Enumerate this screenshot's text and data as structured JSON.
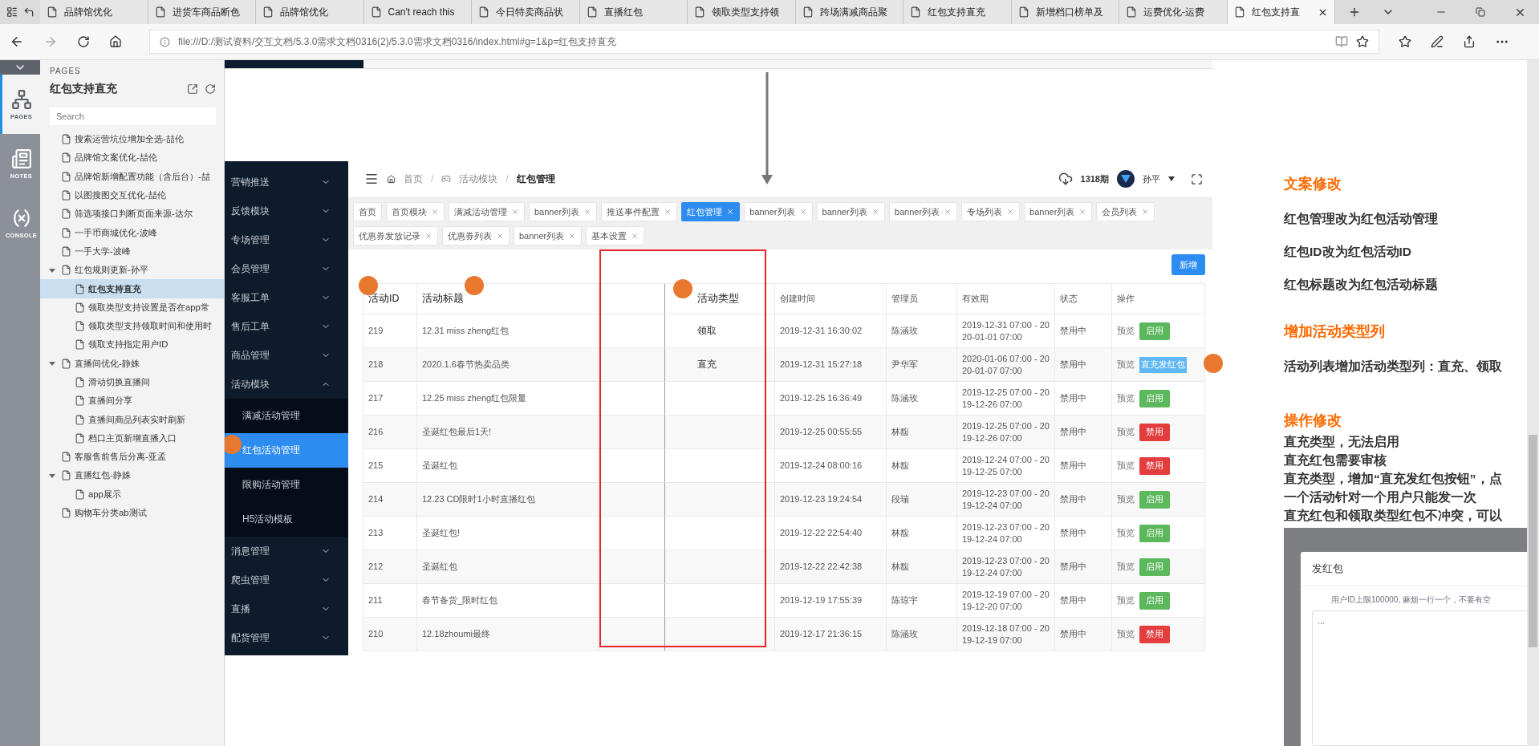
{
  "browser": {
    "tabs": [
      {
        "title": "品牌馆优化",
        "selected": false
      },
      {
        "title": "进货车商品断色",
        "selected": false
      },
      {
        "title": "品牌馆优化",
        "selected": false
      },
      {
        "title": "Can't reach this",
        "selected": false
      },
      {
        "title": "今日特卖商品状",
        "selected": false
      },
      {
        "title": "直播红包",
        "selected": false
      },
      {
        "title": "领取类型支持领",
        "selected": false
      },
      {
        "title": "跨场满减商品聚",
        "selected": false
      },
      {
        "title": "红包支持直充",
        "selected": false
      },
      {
        "title": "新增档口榜单及",
        "selected": false
      },
      {
        "title": "运费优化-运费",
        "selected": false
      },
      {
        "title": "红包支持直",
        "selected": true
      }
    ],
    "url": "file:///D:/测试资料/交互文档/5.3.0需求文档0316(2)/5.3.0需求文档0316/index.html#g=1&p=红包支持直充"
  },
  "rail": [
    {
      "label": "PAGES",
      "kind": "pages",
      "selected": true
    },
    {
      "label": "NOTES",
      "kind": "notes",
      "selected": false
    },
    {
      "label": "CONSOLE",
      "kind": "console",
      "selected": false
    }
  ],
  "pages": {
    "caption": "PAGES",
    "title": "红包支持直充",
    "search": {
      "placeholder": "Search"
    },
    "tree": [
      {
        "label": "搜索运营坑位增加全选-喆伦",
        "selected": false
      },
      {
        "label": "品牌馆文案优化-喆伦",
        "selected": false
      },
      {
        "label": "品牌馆新增配置功能（含后台）-喆",
        "selected": false
      },
      {
        "label": "以图搜图交互优化-喆伦",
        "selected": false
      },
      {
        "label": "筛选项接口判断页面来源-达尔",
        "selected": false
      },
      {
        "label": "一手币商城优化-波峰",
        "selected": false
      },
      {
        "label": "一手大学-波峰",
        "selected": false
      },
      {
        "label": "红包规则更新-孙平",
        "selected": false,
        "expanded": true,
        "children": [
          {
            "label": "红包支持直充",
            "selected": true
          },
          {
            "label": "领取类型支持设置是否在app常",
            "selected": false
          },
          {
            "label": "领取类型支持领取时间和使用时",
            "selected": false
          },
          {
            "label": "领取支持指定用户ID",
            "selected": false
          }
        ]
      },
      {
        "label": "直播间优化-静姝",
        "selected": false,
        "expanded": true,
        "children": [
          {
            "label": "滑动切换直播间",
            "selected": false
          },
          {
            "label": "直播间分享",
            "selected": false
          },
          {
            "label": "直播间商品列表实时刷新",
            "selected": false
          },
          {
            "label": "档口主页新增直播入口",
            "selected": false
          }
        ]
      },
      {
        "label": "客服售前售后分离-亚孟",
        "selected": false
      },
      {
        "label": "直播红包-静姝",
        "selected": false,
        "expanded": true,
        "children": [
          {
            "label": "app展示",
            "selected": false
          }
        ]
      },
      {
        "label": "购物车分类ab测试",
        "selected": false
      }
    ]
  },
  "admin": {
    "menu": [
      {
        "label": "营销推送",
        "expanded": false
      },
      {
        "label": "反馈模块",
        "expanded": false
      },
      {
        "label": "专场管理",
        "expanded": false
      },
      {
        "label": "会员管理",
        "expanded": false
      },
      {
        "label": "客服工单",
        "expanded": false
      },
      {
        "label": "售后工单",
        "expanded": false
      },
      {
        "label": "商品管理",
        "expanded": false
      },
      {
        "label": "活动模块",
        "expanded": true,
        "children": [
          {
            "label": "满减活动管理",
            "selected": false
          },
          {
            "label": "红包活动管理",
            "selected": true
          },
          {
            "label": "限购活动管理",
            "selected": false
          },
          {
            "label": "H5活动模板",
            "selected": false
          }
        ]
      },
      {
        "label": "消息管理",
        "expanded": false
      },
      {
        "label": "爬虫管理",
        "expanded": false
      },
      {
        "label": "直播",
        "expanded": false
      },
      {
        "label": "配货管理",
        "expanded": false
      }
    ],
    "separator": "/",
    "breadcrumbs": [
      {
        "label": "首页",
        "kind": "home"
      },
      {
        "label": "活动模块",
        "kind": "module"
      },
      {
        "label": "红包管理",
        "kind": "page"
      }
    ],
    "issue": "1318期",
    "user": "孙平",
    "tag_rows": [
      [
        {
          "label": "首页",
          "selected": false,
          "closable": false
        },
        {
          "label": "首页模块",
          "selected": false,
          "closable": true
        },
        {
          "label": "满减活动管理",
          "selected": false,
          "closable": true
        },
        {
          "label": "banner列表",
          "selected": false,
          "closable": true
        },
        {
          "label": "推送事件配置",
          "selected": false,
          "closable": true
        },
        {
          "label": "红包管理",
          "selected": true,
          "closable": true
        },
        {
          "label": "banner列表",
          "selected": false,
          "closable": true
        },
        {
          "label": "banner列表",
          "selected": false,
          "closable": true
        },
        {
          "label": "banner列表",
          "selected": false,
          "closable": true
        },
        {
          "label": "专场列表",
          "selected": false,
          "closable": true
        },
        {
          "label": "banner列表",
          "selected": false,
          "closable": true
        },
        {
          "label": "会员列表",
          "selected": false,
          "closable": true
        }
      ],
      [
        {
          "label": "优惠券发放记录",
          "selected": false,
          "closable": true
        },
        {
          "label": "优惠券列表",
          "selected": false,
          "closable": true
        },
        {
          "label": "banner列表",
          "selected": false,
          "closable": true
        },
        {
          "label": "基本设置",
          "selected": false,
          "closable": true
        }
      ]
    ],
    "add_button": "新增",
    "columns": [
      {
        "label": "活动ID",
        "kind": "text"
      },
      {
        "label": "活动标题",
        "kind": "text"
      },
      {
        "kind": "blank"
      },
      {
        "label": "活动类型",
        "kind": "type"
      },
      {
        "label": "创建时间",
        "kind": "text"
      },
      {
        "label": "管理员",
        "kind": "text"
      },
      {
        "label": "有效期",
        "kind": "wrap"
      },
      {
        "label": "状态",
        "kind": "text"
      },
      {
        "label": "操作",
        "kind": "actions"
      }
    ],
    "rows": [
      {
        "id": "219",
        "title": "12.31 miss zheng红包",
        "type": "领取",
        "created": "2019-12-31 16:30:02",
        "admin": "陈涵玫",
        "validity": "2019-12-31 07:00 - 2020-01-01 07:00",
        "status": "禁用中",
        "preview": "预览",
        "action": {
          "label": "启用",
          "kind": "enable"
        }
      },
      {
        "id": "218",
        "title": "2020.1.6春节热卖品类",
        "type": "直充",
        "created": "2019-12-31 15:27:18",
        "admin": "尹华军",
        "validity": "2020-01-06 07:00 - 2020-01-07 07:00",
        "status": "禁用中",
        "preview": "预览",
        "action": {
          "label": "直充发红包",
          "kind": "send"
        }
      },
      {
        "id": "217",
        "title": "12.25 miss zheng红包限量",
        "created": "2019-12-25 16:36:49",
        "admin": "陈涵玫",
        "validity": "2019-12-25 07:00 - 2019-12-26 07:00",
        "status": "禁用中",
        "preview": "预览",
        "action": {
          "label": "启用",
          "kind": "enable"
        }
      },
      {
        "id": "216",
        "title": "圣诞红包最后1天!",
        "created": "2019-12-25 00:55:55",
        "admin": "林馥",
        "validity": "2019-12-25 07:00 - 2019-12-26 07:00",
        "status": "禁用中",
        "preview": "预览",
        "action": {
          "label": "禁用",
          "kind": "disable"
        }
      },
      {
        "id": "215",
        "title": "圣诞红包",
        "created": "2019-12-24 08:00:16",
        "admin": "林馥",
        "validity": "2019-12-24 07:00 - 2019-12-25 07:00",
        "status": "禁用中",
        "preview": "预览",
        "action": {
          "label": "禁用",
          "kind": "disable"
        }
      },
      {
        "id": "214",
        "title": "12.23 CD限时1小时直播红包",
        "created": "2019-12-23 19:24:54",
        "admin": "段瑞",
        "validity": "2019-12-23 07:00 - 2019-12-24 07:00",
        "status": "禁用中",
        "preview": "预览",
        "action": {
          "label": "启用",
          "kind": "enable"
        }
      },
      {
        "id": "213",
        "title": "圣诞红包!",
        "created": "2019-12-22 22:54:40",
        "admin": "林馥",
        "validity": "2019-12-23 07:00 - 2019-12-24 07:00",
        "status": "禁用中",
        "preview": "预览",
        "action": {
          "label": "启用",
          "kind": "enable"
        }
      },
      {
        "id": "212",
        "title": "圣诞红包",
        "created": "2019-12-22 22:42:38",
        "admin": "林馥",
        "validity": "2019-12-23 07:00 - 2019-12-24 07:00",
        "status": "禁用中",
        "preview": "预览",
        "action": {
          "label": "启用",
          "kind": "enable"
        }
      },
      {
        "id": "211",
        "title": "春节备货_限时红包",
        "created": "2019-12-19 17:55:39",
        "admin": "陈琼宇",
        "validity": "2019-12-19 07:00 - 2019-12-20 07:00",
        "status": "禁用中",
        "preview": "预览",
        "action": {
          "label": "启用",
          "kind": "enable"
        }
      },
      {
        "id": "210",
        "title": "12.18zhoumi最终",
        "created": "2019-12-17 21:36:15",
        "admin": "陈涵玫",
        "validity": "2019-12-18 07:00 - 2019-12-19 07:00",
        "status": "禁用中",
        "preview": "预览",
        "action": {
          "label": "禁用",
          "kind": "disable"
        }
      }
    ]
  },
  "notes": [
    {
      "heading": "文案修改",
      "kind": "spaced",
      "lines": [
        "红包管理改为红包活动管理",
        "红包ID改为红包活动ID",
        "红包标题改为红包活动标题"
      ]
    },
    {
      "heading": "增加活动类型列",
      "kind": "spaced",
      "lines": [
        "活动列表增加活动类型列：直充、领取"
      ]
    },
    {
      "heading": "操作修改",
      "kind": "compact",
      "lines": [
        "直充类型，无法启用",
        "直充红包需要审核",
        "直充类型，增加“直充发红包按钮”，点",
        "一个活动针对一个用户只能发一次",
        "直充红包和领取类型红包不冲突，可以"
      ]
    }
  ],
  "dialog": {
    "title": "发红包",
    "hint": "用户ID上限100000, 麻烦一行一个，不要有空",
    "placeholder": "..."
  }
}
